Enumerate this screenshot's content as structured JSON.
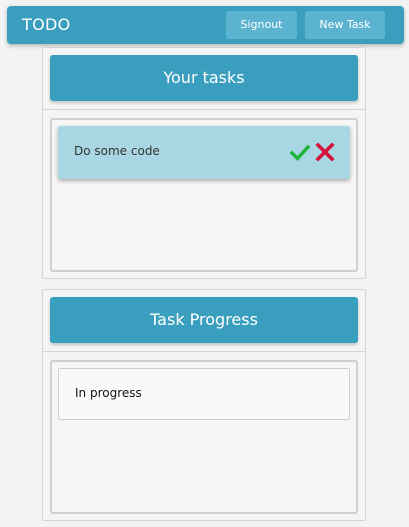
{
  "navbar": {
    "brand": "TODO",
    "signout_label": "Signout",
    "new_task_label": "New Task"
  },
  "tasks_panel": {
    "title": "Your tasks",
    "tasks": [
      {
        "text": "Do some code"
      }
    ]
  },
  "progress_panel": {
    "title": "Task Progress",
    "items": [
      {
        "text": "In progress"
      }
    ]
  },
  "colors": {
    "primary": "#3a9fbf",
    "nav_button": "#5cb3cf",
    "task_card": "#a9d6e3",
    "check": "#1fb53a",
    "cross": "#d6123a"
  },
  "icons": {
    "done": "check-icon",
    "remove": "cross-icon"
  }
}
